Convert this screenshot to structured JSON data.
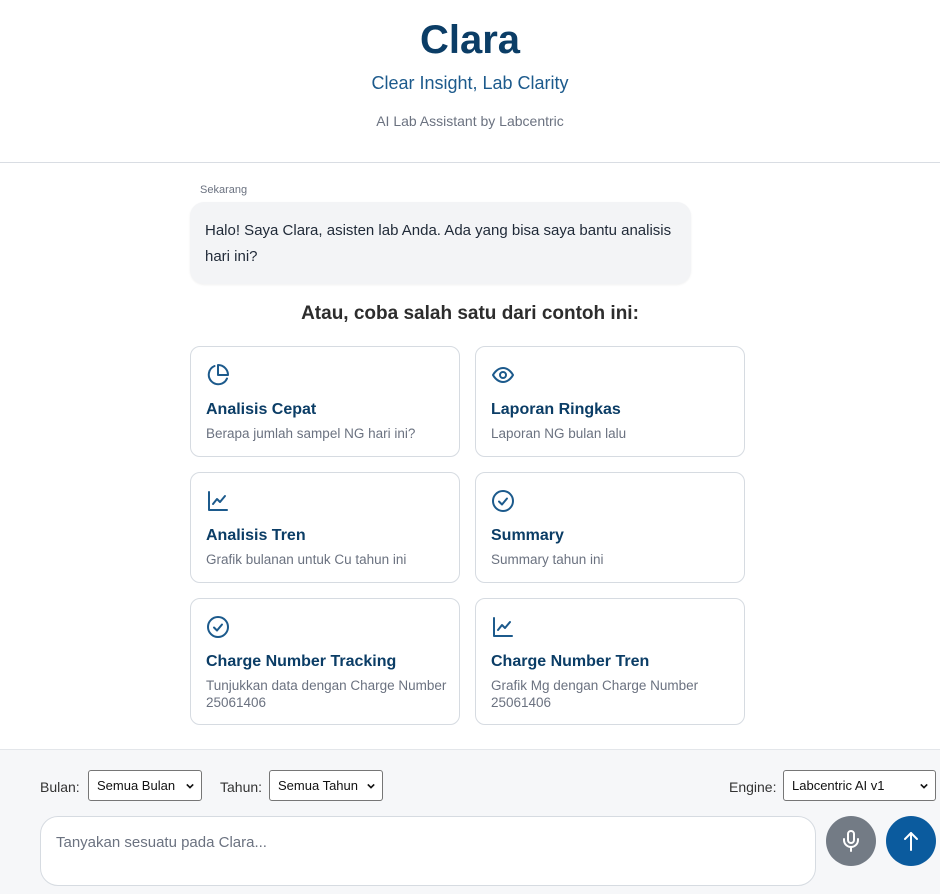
{
  "header": {
    "title": "Clara",
    "tagline": "Clear Insight, Lab Clarity",
    "subtitle": "AI Lab Assistant by Labcentric"
  },
  "chat": {
    "messages": [
      {
        "time": "Sekarang",
        "text": "Halo! Saya Clara, asisten lab Anda. Ada yang bisa saya bantu analisis hari ini?"
      }
    ]
  },
  "suggestions": {
    "heading": "Atau, coba salah satu dari contoh ini:",
    "cards": [
      {
        "icon": "pie-chart-icon",
        "title": "Analisis Cepat",
        "description": "Berapa jumlah sampel NG hari ini?"
      },
      {
        "icon": "eye-icon",
        "title": "Laporan Ringkas",
        "description": "Laporan NG bulan lalu"
      },
      {
        "icon": "line-chart-icon",
        "title": "Analisis Tren",
        "description": "Grafik bulanan untuk Cu tahun ini"
      },
      {
        "icon": "check-circle-icon",
        "title": "Summary",
        "description": "Summary tahun ini"
      },
      {
        "icon": "check-circle-icon",
        "title": "Charge Number Tracking",
        "description": "Tunjukkan data dengan Charge Number 25061406"
      },
      {
        "icon": "line-chart-icon",
        "title": "Charge Number Tren",
        "description": "Grafik Mg dengan Charge Number 25061406"
      }
    ]
  },
  "filters": {
    "month_label": "Bulan:",
    "month_value": "Semua Bulan",
    "year_label": "Tahun:",
    "year_value": "Semua Tahun",
    "engine_label": "Engine:",
    "engine_value": "Labcentric AI v1"
  },
  "input": {
    "placeholder": "Tanyakan sesuatu pada Clara..."
  },
  "colors": {
    "brand": "#0b3d66",
    "accent": "#0b5b9e",
    "mic_button": "#737b85"
  }
}
